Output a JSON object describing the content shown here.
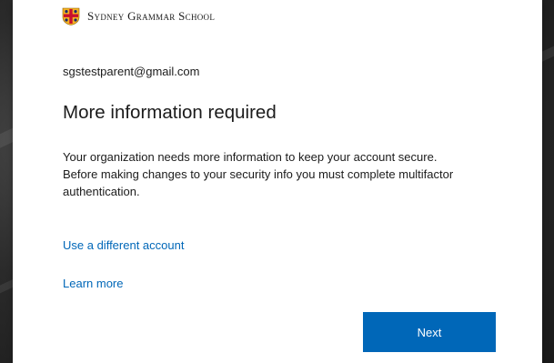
{
  "logo": {
    "icon": "sydney-grammar-crest",
    "text": "Sydney Grammar School",
    "colors": {
      "crest_primary": "#f4b223",
      "crest_secondary": "#1a2a6c",
      "crest_cross": "#c8102e"
    }
  },
  "account": {
    "email": "sgstestparent@gmail.com"
  },
  "main": {
    "title": "More information required",
    "description": "Your organization needs more information to keep your account secure. Before making changes to your security info you must complete multifactor authentication."
  },
  "links": {
    "different_account": "Use a different account",
    "learn_more": "Learn more"
  },
  "actions": {
    "next_label": "Next"
  },
  "colors": {
    "accent": "#0067b8",
    "text": "#1b1b1b",
    "background": "#ffffff"
  }
}
